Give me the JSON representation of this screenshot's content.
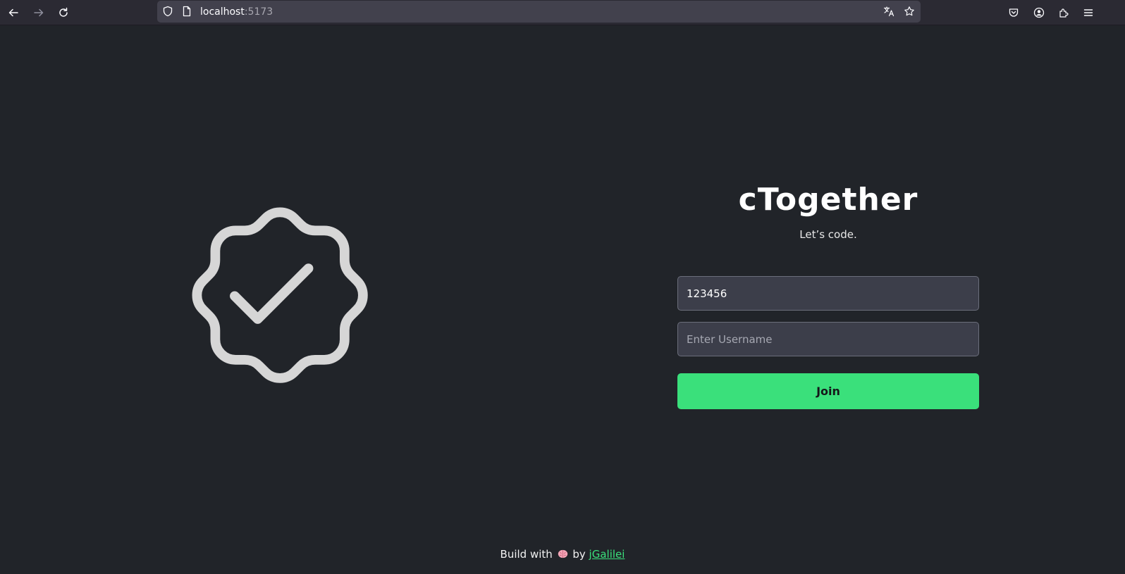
{
  "browser": {
    "url_host": "localhost",
    "url_port": ":5173",
    "icons": [
      "back-icon",
      "forward-icon",
      "reload-icon",
      "shield-icon",
      "page-icon",
      "translate-icon",
      "bookmark-star-icon",
      "pocket-icon",
      "account-icon",
      "extensions-icon",
      "menu-icon"
    ]
  },
  "page": {
    "title": "cTogether",
    "subtitle": "Let’s code.",
    "room_value": "123456",
    "username_placeholder": "Enter Username",
    "join_label": "Join",
    "footer": {
      "prefix": "Build with",
      "suffix": "by",
      "author": "jGalilei"
    }
  },
  "colors": {
    "background": "#212429",
    "accent": "#3ae07b",
    "badge": "#d6d6d6"
  }
}
